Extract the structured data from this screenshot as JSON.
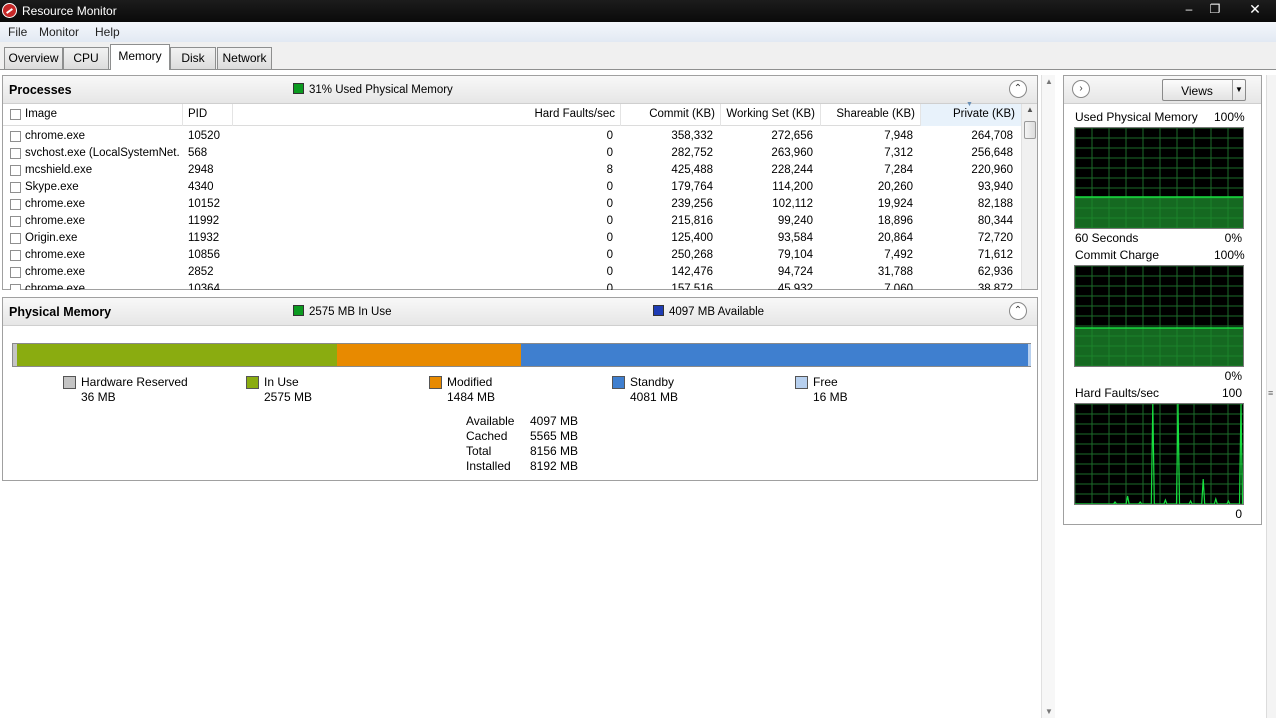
{
  "window": {
    "title": "Resource Monitor"
  },
  "menu": {
    "items": [
      "File",
      "Monitor",
      "Help"
    ]
  },
  "tabs": [
    "Overview",
    "CPU",
    "Memory",
    "Disk",
    "Network"
  ],
  "active_tab": "Memory",
  "processes": {
    "title": "Processes",
    "status": "31% Used Physical Memory",
    "columns": [
      "Image",
      "PID",
      "Hard Faults/sec",
      "Commit (KB)",
      "Working Set (KB)",
      "Shareable (KB)",
      "Private (KB)"
    ],
    "sorted_column": "Private (KB)",
    "rows": [
      [
        "chrome.exe",
        "10520",
        "0",
        "358,332",
        "272,656",
        "7,948",
        "264,708"
      ],
      [
        "svchost.exe (LocalSystemNet...",
        "568",
        "0",
        "282,752",
        "263,960",
        "7,312",
        "256,648"
      ],
      [
        "mcshield.exe",
        "2948",
        "8",
        "425,488",
        "228,244",
        "7,284",
        "220,960"
      ],
      [
        "Skype.exe",
        "4340",
        "0",
        "179,764",
        "114,200",
        "20,260",
        "93,940"
      ],
      [
        "chrome.exe",
        "10152",
        "0",
        "239,256",
        "102,112",
        "19,924",
        "82,188"
      ],
      [
        "chrome.exe",
        "11992",
        "0",
        "215,816",
        "99,240",
        "18,896",
        "80,344"
      ],
      [
        "Origin.exe",
        "11932",
        "0",
        "125,400",
        "93,584",
        "20,864",
        "72,720"
      ],
      [
        "chrome.exe",
        "10856",
        "0",
        "250,268",
        "79,104",
        "7,492",
        "71,612"
      ],
      [
        "chrome.exe",
        "2852",
        "0",
        "142,476",
        "94,724",
        "31,788",
        "62,936"
      ],
      [
        "chrome.exe",
        "10364",
        "0",
        "157,516",
        "45,932",
        "7,060",
        "38,872"
      ]
    ]
  },
  "physical_memory": {
    "title": "Physical Memory",
    "in_use_status": "2575 MB In Use",
    "available_status": "4097 MB Available",
    "segments": [
      {
        "label": "Hardware Reserved",
        "value": "36 MB",
        "mb": 36,
        "color": "#c4c4c4"
      },
      {
        "label": "In Use",
        "value": "2575 MB",
        "mb": 2575,
        "color": "#8aac10"
      },
      {
        "label": "Modified",
        "value": "1484 MB",
        "mb": 1484,
        "color": "#e88a00"
      },
      {
        "label": "Standby",
        "value": "4081 MB",
        "mb": 4081,
        "color": "#3f7fcf"
      },
      {
        "label": "Free",
        "value": "16 MB",
        "mb": 16,
        "color": "#b7d0ef"
      }
    ],
    "summary": [
      {
        "label": "Available",
        "value": "4097 MB"
      },
      {
        "label": "Cached",
        "value": "5565 MB"
      },
      {
        "label": "Total",
        "value": "8156 MB"
      },
      {
        "label": "Installed",
        "value": "8192 MB"
      }
    ]
  },
  "graphs": {
    "views_label": "Views",
    "used_physical_memory": {
      "label": "Used Physical Memory",
      "max": "100%",
      "min": "0%",
      "time": "60 Seconds",
      "level_percent": 31
    },
    "commit_charge": {
      "label": "Commit Charge",
      "max": "100%",
      "min": "0%",
      "level_percent": 38
    },
    "hard_faults": {
      "label": "Hard Faults/sec",
      "max": "100",
      "min": "0",
      "spikes": [
        2,
        8,
        2,
        100,
        4,
        100,
        3,
        25,
        5,
        3,
        100
      ]
    }
  },
  "colors": {
    "graph_line": "#18e040",
    "graph_grid": "#1d6b2a",
    "graph_fill": "#1c8c2c"
  }
}
